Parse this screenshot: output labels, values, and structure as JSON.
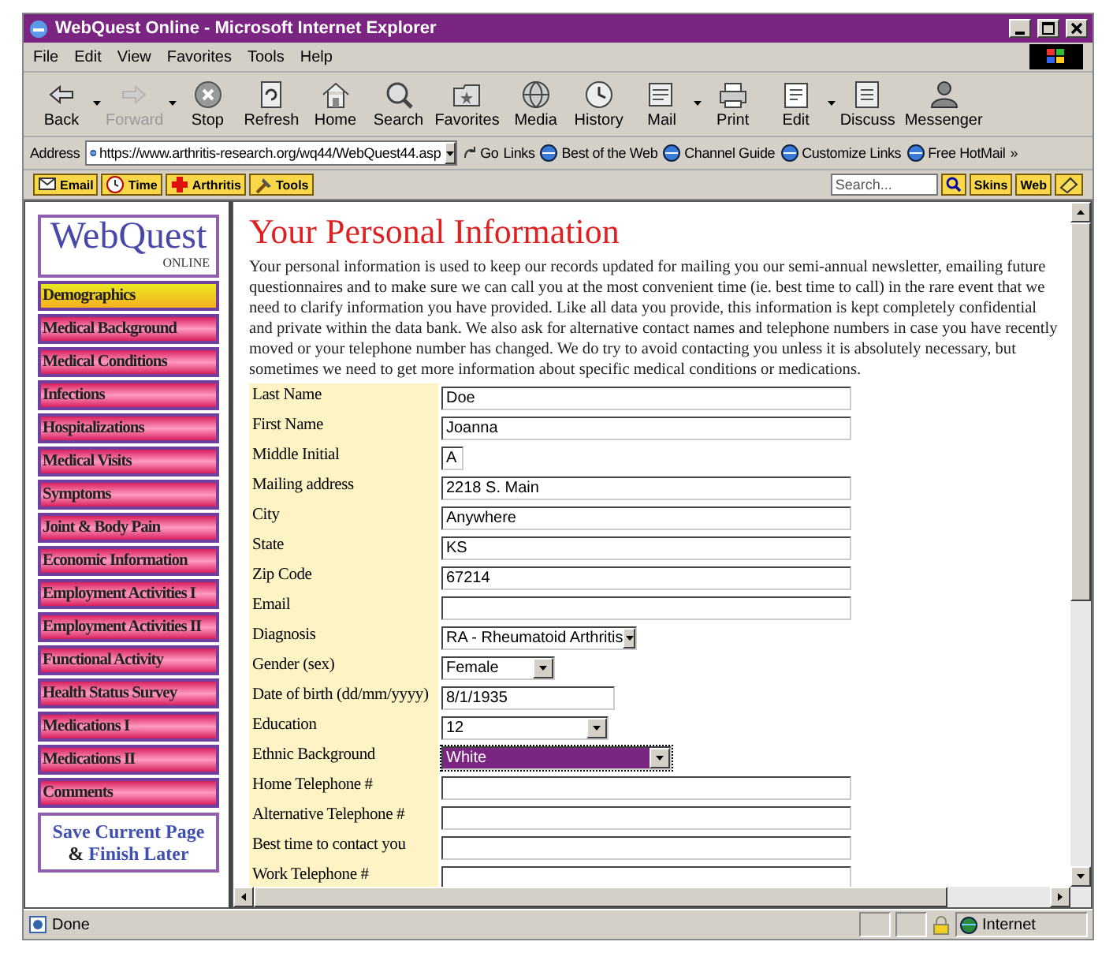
{
  "window": {
    "title": "WebQuest Online - Microsoft Internet Explorer"
  },
  "menu": [
    "File",
    "Edit",
    "View",
    "Favorites",
    "Tools",
    "Help"
  ],
  "toolbar": [
    {
      "label": "Back",
      "disabled": false,
      "dropdown": true
    },
    {
      "label": "Forward",
      "disabled": true,
      "dropdown": true
    },
    {
      "label": "Stop",
      "disabled": false,
      "dropdown": false
    },
    {
      "label": "Refresh",
      "disabled": false,
      "dropdown": false
    },
    {
      "label": "Home",
      "disabled": false,
      "dropdown": false
    },
    {
      "label": "Search",
      "disabled": false,
      "dropdown": false
    },
    {
      "label": "Favorites",
      "disabled": false,
      "dropdown": false
    },
    {
      "label": "Media",
      "disabled": false,
      "dropdown": false
    },
    {
      "label": "History",
      "disabled": false,
      "dropdown": false
    },
    {
      "label": "Mail",
      "disabled": false,
      "dropdown": true
    },
    {
      "label": "Print",
      "disabled": false,
      "dropdown": false
    },
    {
      "label": "Edit",
      "disabled": false,
      "dropdown": true
    },
    {
      "label": "Discuss",
      "disabled": false,
      "dropdown": false
    },
    {
      "label": "Messenger",
      "disabled": false,
      "dropdown": false
    }
  ],
  "address": {
    "label": "Address",
    "url": "https://www.arthritis-research.org/wq44/WebQuest44.asp",
    "go": "Go",
    "links_label": "Links",
    "links": [
      "Best of the Web",
      "Channel Guide",
      "Customize Links",
      "Free HotMail"
    ],
    "more": "»"
  },
  "custom_toolbar": {
    "buttons": [
      "Email",
      "Time",
      "Arthritis",
      "Tools"
    ],
    "search_placeholder": "Search...",
    "right_buttons": [
      "Skins",
      "Web"
    ]
  },
  "sidebar": {
    "logo": "WebQuest",
    "logo_sub": "ONLINE",
    "items": [
      {
        "label": "Demographics",
        "selected": true
      },
      {
        "label": "Medical Background",
        "selected": false
      },
      {
        "label": "Medical Conditions",
        "selected": false
      },
      {
        "label": "Infections",
        "selected": false
      },
      {
        "label": "Hospitalizations",
        "selected": false
      },
      {
        "label": "Medical Visits",
        "selected": false
      },
      {
        "label": "Symptoms",
        "selected": false
      },
      {
        "label": "Joint & Body Pain",
        "selected": false
      },
      {
        "label": "Economic Information",
        "selected": false
      },
      {
        "label": "Employment Activities I",
        "selected": false
      },
      {
        "label": "Employment Activities II",
        "selected": false
      },
      {
        "label": "Functional Activity",
        "selected": false
      },
      {
        "label": "Health Status Survey",
        "selected": false
      },
      {
        "label": "Medications I",
        "selected": false
      },
      {
        "label": "Medications II",
        "selected": false
      },
      {
        "label": "Comments",
        "selected": false
      }
    ],
    "save_link": {
      "line1": "Save Current Page",
      "amp": "&",
      "line2": "Finish Later"
    }
  },
  "page": {
    "heading": "Your Personal Information",
    "intro": "Your personal information is used to keep our records updated for mailing you our semi-annual newsletter, emailing future questionnaires and to make sure we can call you at the most convenient time (ie. best time to call) in the rare event that we need to clarify information you have provided. Like all data you provide, this information is kept completely confidential and private within the data bank. We also ask for alternative contact names and telephone numbers in case you have recently moved or your telephone number has changed. We do try to avoid contacting you unless it is absolutely necessary, but sometimes we need to get more information about specific medical conditions or medications.",
    "fields": [
      {
        "label": "Last Name",
        "kind": "text",
        "value": "Doe",
        "highlighted": false
      },
      {
        "label": "First Name",
        "kind": "text",
        "value": "Joanna",
        "highlighted": false
      },
      {
        "label": "Middle Initial",
        "kind": "initial",
        "value": "A",
        "highlighted": false
      },
      {
        "label": "Mailing address",
        "kind": "text",
        "value": "2218 S. Main",
        "highlighted": false
      },
      {
        "label": "City",
        "kind": "text",
        "value": "Anywhere",
        "highlighted": false
      },
      {
        "label": "State",
        "kind": "text",
        "value": "KS",
        "highlighted": false
      },
      {
        "label": "Zip Code",
        "kind": "text",
        "value": "67214",
        "highlighted": false
      },
      {
        "label": "Email",
        "kind": "text",
        "highlighted": false
      },
      {
        "label": "Diagnosis",
        "kind": "select",
        "value": "RA - Rheumatoid Arthritis",
        "highlighted": false
      },
      {
        "label": "Gender (sex)",
        "kind": "select",
        "value": "Female",
        "highlighted": false
      },
      {
        "label": "Date of birth (dd/mm/yyyy)",
        "kind": "date",
        "value": "8/1/1935",
        "highlighted": false
      },
      {
        "label": "Education",
        "kind": "select",
        "value": "12",
        "highlighted": false
      },
      {
        "label": "Ethnic Background",
        "kind": "select",
        "value": "White",
        "highlighted": true
      },
      {
        "label": "Home Telephone #",
        "kind": "text",
        "highlighted": false
      },
      {
        "label": "Alternative Telephone #",
        "kind": "text",
        "highlighted": false
      },
      {
        "label": "Best time to contact you",
        "kind": "text",
        "highlighted": false
      },
      {
        "label": "Work Telephone #",
        "kind": "text",
        "highlighted": false
      }
    ]
  },
  "status_bar": {
    "text": "Done",
    "zone": "Internet"
  }
}
